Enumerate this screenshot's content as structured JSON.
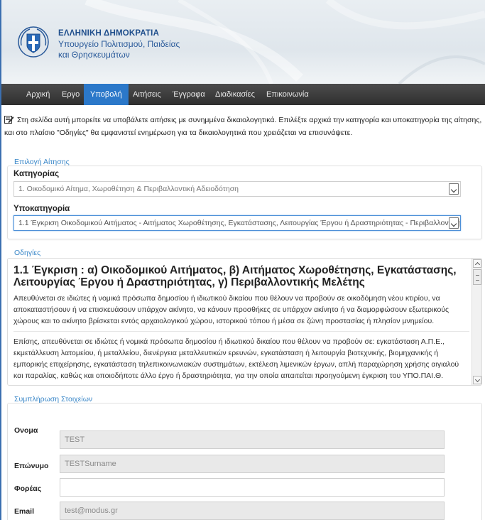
{
  "header": {
    "org_line1": "ΕΛΛΗΝΙΚΗ ΔΗΜΟΚΡΑΤΙΑ",
    "org_line2": "Υπουργείο Πολιτισμού, Παιδείας",
    "org_line3": "και Θρησκευμάτων"
  },
  "nav": {
    "items": [
      {
        "label": "Αρχική"
      },
      {
        "label": "Εργο"
      },
      {
        "label": "Υποβολή"
      },
      {
        "label": "Αιτήσεις"
      },
      {
        "label": "Έγγραφα"
      },
      {
        "label": "Διαδικασίες"
      },
      {
        "label": "Επικοινωνία"
      }
    ],
    "active": "Υποβολή"
  },
  "intro": {
    "text": "Στη σελίδα αυτή μπορείτε να υποβάλετε αιτήσεις με συνημμένα δικαιολογητικά. Επιλέξτε αρχικά την κατηγορία και υποκατηγορία της αίτησης, και στο πλαίσιο \"Οδηγίες\" θα εμφανιστεί ενημέρωση για τα δικαιολογητικά που χρειάζεται να επισυνάψετε."
  },
  "selection": {
    "section_title": "Επιλογή Αίτησης",
    "category_label": "Κατηγορίας",
    "category_value": "1. Οικοδομικό Αίτημα, Χωροθέτηση & Περιβαλλοντική Αδειοδότηση",
    "subcategory_label": "Υποκατηγορία",
    "subcategory_value": "1.1 Έγκριση Οικοδομικού Αιτήματος - Αιτήματος Χωροθέτησης, Εγκατάστασης, Λειτουργίας Έργου ή Δραστηριότητας - Περιβαλλοντικής Μελέτης"
  },
  "instructions": {
    "section_title": "Οδηγίες",
    "title": "1.1 Έγκριση : α) Οικοδομικού Αιτήματος, β) Αιτήματος Χωροθέτησης, Εγκατάστασης, Λειτουργίας Έργου ή Δραστηριότητας, γ) Περιβαλλοντικής Μελέτης",
    "p1": "Απευθύνεται σε ιδιώτες ή νομικά πρόσωπα δημοσίου ή ιδιωτικού δικαίου που θέλουν να προβούν σε οικοδόμηση νέου κτιρίου, να αποκαταστήσουν ή να επισκευάσουν υπάρχον ακίνητο, να κάνουν προσθήκες σε υπάρχον ακίνητο ή να διαμορφώσουν εξωτερικούς χώρους και το ακίνητο βρίσκεται εντός αρχαιολογικού χώρου, ιστορικού τόπου ή μέσα σε ζώνη προστασίας ή πλησίον μνημείου.",
    "p2": "Επίσης, απευθύνεται σε ιδιώτες ή νομικά πρόσωπα δημοσίου ή ιδιωτικού δικαίου που θέλουν να προβούν σε: εγκατάσταση Α.Π.Ε., εκμετάλλευση λατομείου, ή μεταλλείου, διενέργεια μεταλλευτικών ερευνών, εγκατάσταση ή λειτουργία βιοτεχνικής, βιομηχανικής ή εμπορικής επιχείρησης, εγκατάσταση τηλεπικοινωνιακών συστημάτων, εκτέλεση λιμενικών έργων, απλή παραχώρηση χρήσης αιγιαλού και παραλίας, καθώς και οποιοδήποτε άλλο έργο ή δραστηριότητα, για την οποία απαιτείται προηγούμενη έγκριση του ΥΠΟ.ΠΑΙ.Θ."
  },
  "form": {
    "section_title": "Συμπλήρωση Στοιχείων",
    "name_label": "Ονομα",
    "name_value": "TEST",
    "surname_label": "Επώνυμο",
    "surname_value": "TESTSurname",
    "org_label": "Φορέας",
    "org_value": "",
    "email_label": "Email",
    "email_value": "test@modus.gr"
  },
  "colors": {
    "nav_active": "#2b78c9",
    "section_title": "#3a87c8",
    "header_text": "#1f4e8c"
  }
}
